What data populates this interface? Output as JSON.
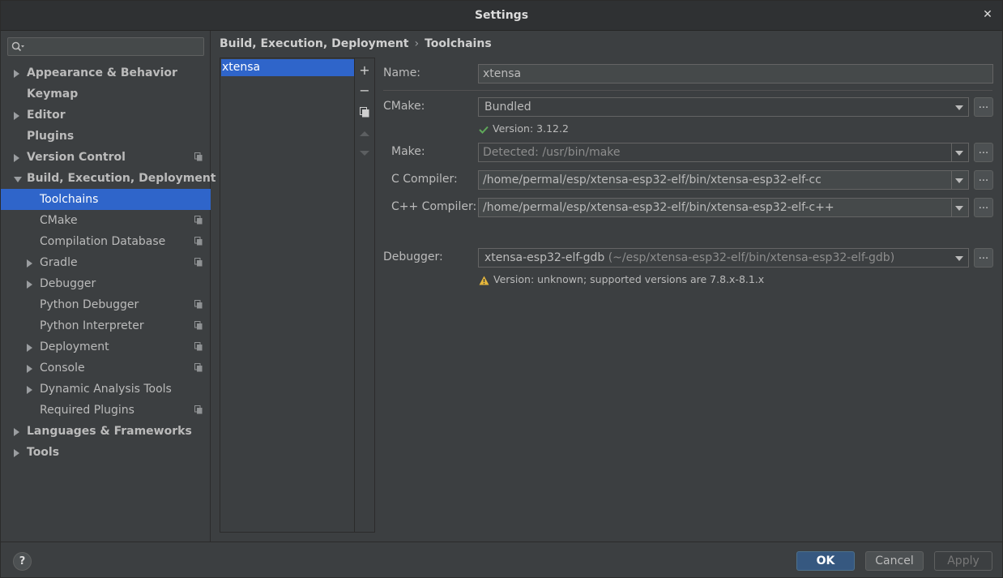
{
  "window": {
    "title": "Settings"
  },
  "search": {
    "placeholder": "",
    "value": ""
  },
  "sidebar": {
    "items": [
      {
        "label": "Appearance & Behavior",
        "level": 0,
        "expander": "collapsed",
        "copy_icon": false
      },
      {
        "label": "Keymap",
        "level": 0,
        "expander": "none",
        "copy_icon": false
      },
      {
        "label": "Editor",
        "level": 0,
        "expander": "collapsed",
        "copy_icon": false
      },
      {
        "label": "Plugins",
        "level": 0,
        "expander": "none",
        "copy_icon": false
      },
      {
        "label": "Version Control",
        "level": 0,
        "expander": "collapsed",
        "copy_icon": true
      },
      {
        "label": "Build, Execution, Deployment",
        "level": 0,
        "expander": "expanded",
        "copy_icon": false
      },
      {
        "label": "Toolchains",
        "level": 1,
        "expander": "none",
        "copy_icon": false,
        "selected": true
      },
      {
        "label": "CMake",
        "level": 1,
        "expander": "none",
        "copy_icon": true
      },
      {
        "label": "Compilation Database",
        "level": 1,
        "expander": "none",
        "copy_icon": true
      },
      {
        "label": "Gradle",
        "level": 1,
        "expander": "collapsed",
        "copy_icon": true
      },
      {
        "label": "Debugger",
        "level": 1,
        "expander": "collapsed",
        "copy_icon": false
      },
      {
        "label": "Python Debugger",
        "level": 1,
        "expander": "none",
        "copy_icon": true
      },
      {
        "label": "Python Interpreter",
        "level": 1,
        "expander": "none",
        "copy_icon": true
      },
      {
        "label": "Deployment",
        "level": 1,
        "expander": "collapsed",
        "copy_icon": true
      },
      {
        "label": "Console",
        "level": 1,
        "expander": "collapsed",
        "copy_icon": true
      },
      {
        "label": "Dynamic Analysis Tools",
        "level": 1,
        "expander": "collapsed",
        "copy_icon": false
      },
      {
        "label": "Required Plugins",
        "level": 1,
        "expander": "none",
        "copy_icon": true
      },
      {
        "label": "Languages & Frameworks",
        "level": 0,
        "expander": "collapsed",
        "copy_icon": false
      },
      {
        "label": "Tools",
        "level": 0,
        "expander": "collapsed",
        "copy_icon": false
      }
    ]
  },
  "breadcrumb": {
    "parent": "Build, Execution, Deployment",
    "separator": "›",
    "current": "Toolchains"
  },
  "toolchains": {
    "items": [
      "xtensa"
    ],
    "tools": {
      "add": "+",
      "remove": "−",
      "copy": "copy-icon",
      "up": "move-up-icon",
      "down": "move-down-icon"
    }
  },
  "form": {
    "name": {
      "label": "Name:",
      "value": "xtensa"
    },
    "cmake": {
      "label": "CMake:",
      "value": "Bundled",
      "status": "Version: 3.12.2",
      "status_icon": "checkmark-icon"
    },
    "make": {
      "label": "Make:",
      "value": "Detected: /usr/bin/make"
    },
    "c_compiler": {
      "label": "C Compiler:",
      "value": "/home/permal/esp/xtensa-esp32-elf/bin/xtensa-esp32-elf-cc"
    },
    "cpp_compiler": {
      "label": "C++ Compiler:",
      "value": "/home/permal/esp/xtensa-esp32-elf/bin/xtensa-esp32-elf-c++"
    },
    "debugger": {
      "label": "Debugger:",
      "value": "xtensa-esp32-elf-gdb",
      "path": "(~/esp/xtensa-esp32-elf/bin/xtensa-esp32-elf-gdb)",
      "status": "Version: unknown; supported versions are 7.8.x-8.1.x",
      "status_icon": "warning-icon"
    },
    "browse_label": "..."
  },
  "footer": {
    "help": "?",
    "ok": "OK",
    "cancel": "Cancel",
    "apply": "Apply"
  },
  "colors": {
    "selection": "#2f65ca",
    "background": "#3c3f41",
    "ok_button": "#365880",
    "success": "#5fa85a",
    "warning": "#e6b73b"
  }
}
